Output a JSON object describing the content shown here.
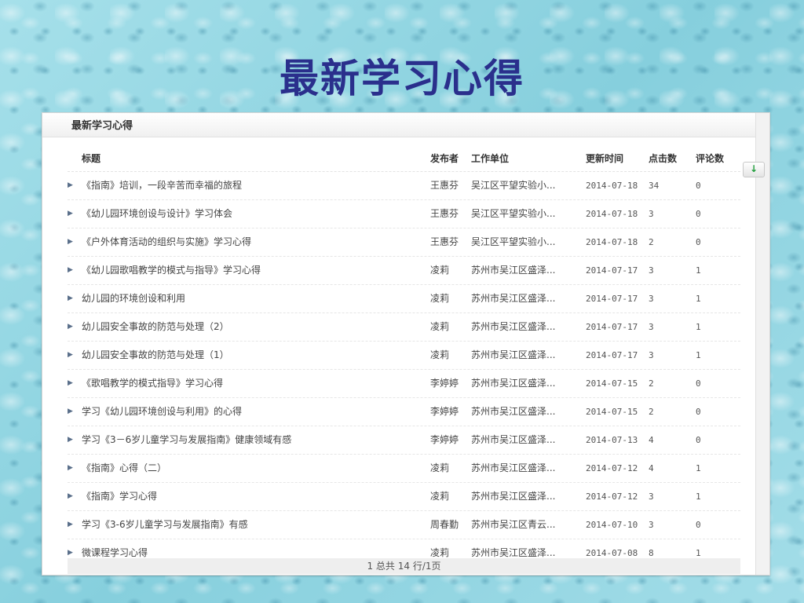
{
  "page": {
    "title": "最新学习心得"
  },
  "panel": {
    "title": "最新学习心得"
  },
  "scroll": {
    "glyph": "↓"
  },
  "table": {
    "columns": {
      "title": "标题",
      "publisher": "发布者",
      "org": "工作单位",
      "date": "更新时间",
      "clicks": "点击数",
      "comments": "评论数"
    },
    "rows": [
      {
        "title": "《指南》培训，一段辛苦而幸福的旅程",
        "publisher": "王惠芬",
        "org": "吴江区平望实验小...",
        "date": "2014-07-18",
        "clicks": "34",
        "comments": "0"
      },
      {
        "title": "《幼儿园环境创设与设计》学习体会",
        "publisher": "王惠芬",
        "org": "吴江区平望实验小...",
        "date": "2014-07-18",
        "clicks": "3",
        "comments": "0"
      },
      {
        "title": "《户外体育活动的组织与实施》学习心得",
        "publisher": "王惠芬",
        "org": "吴江区平望实验小...",
        "date": "2014-07-18",
        "clicks": "2",
        "comments": "0"
      },
      {
        "title": "《幼儿园歌唱教学的模式与指导》学习心得",
        "publisher": "凌莉",
        "org": "苏州市吴江区盛泽...",
        "date": "2014-07-17",
        "clicks": "3",
        "comments": "1"
      },
      {
        "title": "幼儿园的环境创设和利用",
        "publisher": "凌莉",
        "org": "苏州市吴江区盛泽...",
        "date": "2014-07-17",
        "clicks": "3",
        "comments": "1"
      },
      {
        "title": "幼儿园安全事故的防范与处理（2）",
        "publisher": "凌莉",
        "org": "苏州市吴江区盛泽...",
        "date": "2014-07-17",
        "clicks": "3",
        "comments": "1"
      },
      {
        "title": "幼儿园安全事故的防范与处理（1）",
        "publisher": "凌莉",
        "org": "苏州市吴江区盛泽...",
        "date": "2014-07-17",
        "clicks": "3",
        "comments": "1"
      },
      {
        "title": "《歌唱教学的模式指导》学习心得",
        "publisher": "李婷婷",
        "org": "苏州市吴江区盛泽...",
        "date": "2014-07-15",
        "clicks": "2",
        "comments": "0"
      },
      {
        "title": "学习《幼儿园环境创设与利用》的心得",
        "publisher": "李婷婷",
        "org": "苏州市吴江区盛泽...",
        "date": "2014-07-15",
        "clicks": "2",
        "comments": "0"
      },
      {
        "title": "学习《3－6岁儿童学习与发展指南》健康领域有感",
        "publisher": "李婷婷",
        "org": "苏州市吴江区盛泽...",
        "date": "2014-07-13",
        "clicks": "4",
        "comments": "0"
      },
      {
        "title": "《指南》心得（二）",
        "publisher": "凌莉",
        "org": "苏州市吴江区盛泽...",
        "date": "2014-07-12",
        "clicks": "4",
        "comments": "1"
      },
      {
        "title": "《指南》学习心得",
        "publisher": "凌莉",
        "org": "苏州市吴江区盛泽...",
        "date": "2014-07-12",
        "clicks": "3",
        "comments": "1"
      },
      {
        "title": "学习《3-6岁儿童学习与发展指南》有感",
        "publisher": "周春勤",
        "org": "苏州市吴江区青云...",
        "date": "2014-07-10",
        "clicks": "3",
        "comments": "0"
      },
      {
        "title": "微课程学习心得",
        "publisher": "凌莉",
        "org": "苏州市吴江区盛泽...",
        "date": "2014-07-08",
        "clicks": "8",
        "comments": "1"
      }
    ]
  },
  "pager": {
    "text": "1 总共 14 行/1页"
  }
}
